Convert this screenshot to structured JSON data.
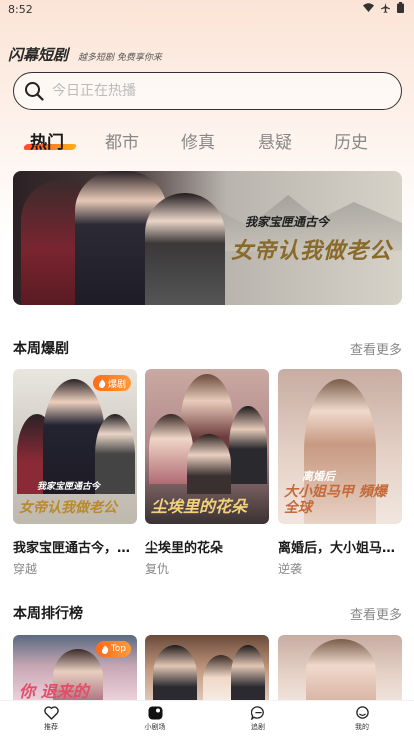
{
  "status_bar": {
    "time": "8:52",
    "icons": [
      "wifi-icon",
      "airplane-icon",
      "battery-icon"
    ]
  },
  "brand": {
    "logo": "闪幕短剧",
    "slogan": "越多短剧 免费享你来"
  },
  "search": {
    "placeholder": "今日正在热播",
    "value": ""
  },
  "tabs": [
    {
      "label": "热门",
      "active": true
    },
    {
      "label": "都市",
      "active": false
    },
    {
      "label": "修真",
      "active": false
    },
    {
      "label": "悬疑",
      "active": false
    },
    {
      "label": "历史",
      "active": false
    }
  ],
  "banner": {
    "subtitle": "我家宝匣通古今",
    "title": "女帝认我做老公"
  },
  "weekly_hot": {
    "title": "本周爆剧",
    "more": "查看更多",
    "items": [
      {
        "title": "我家宝匣通古今，女帝认我做老公",
        "tag": "穿越",
        "badge": "爆剧",
        "poster_sub": "我家宝匣通古今",
        "poster_title": "女帝认我做老公"
      },
      {
        "title": "尘埃里的花朵",
        "tag": "复仇",
        "badge": "",
        "poster_sub": "",
        "poster_title": "尘埃里的花朵"
      },
      {
        "title": "离婚后，大小姐马甲頻爆全球",
        "tag": "逆袭",
        "badge": "",
        "poster_sub": "离婚后",
        "poster_title": "大小姐马甲 頻爆全球"
      }
    ]
  },
  "weekly_rank": {
    "title": "本周排行榜",
    "more": "查看更多",
    "items": [
      {
        "badge": "Top",
        "poster_title": "你 退来的"
      },
      {
        "badge": "",
        "poster_title": ""
      },
      {
        "badge": "",
        "poster_title": ""
      }
    ]
  },
  "bottom_nav": [
    {
      "label": "推荐",
      "icon": "heart-icon"
    },
    {
      "label": "小剧场",
      "icon": "theater-icon"
    },
    {
      "label": "追剧",
      "icon": "chat-icon"
    },
    {
      "label": "我的",
      "icon": "profile-icon"
    }
  ],
  "colors": {
    "accent": "#ff5a1f",
    "badge_start": "#ff6a1a",
    "badge_end": "#ff9a3a",
    "muted": "#888888"
  }
}
